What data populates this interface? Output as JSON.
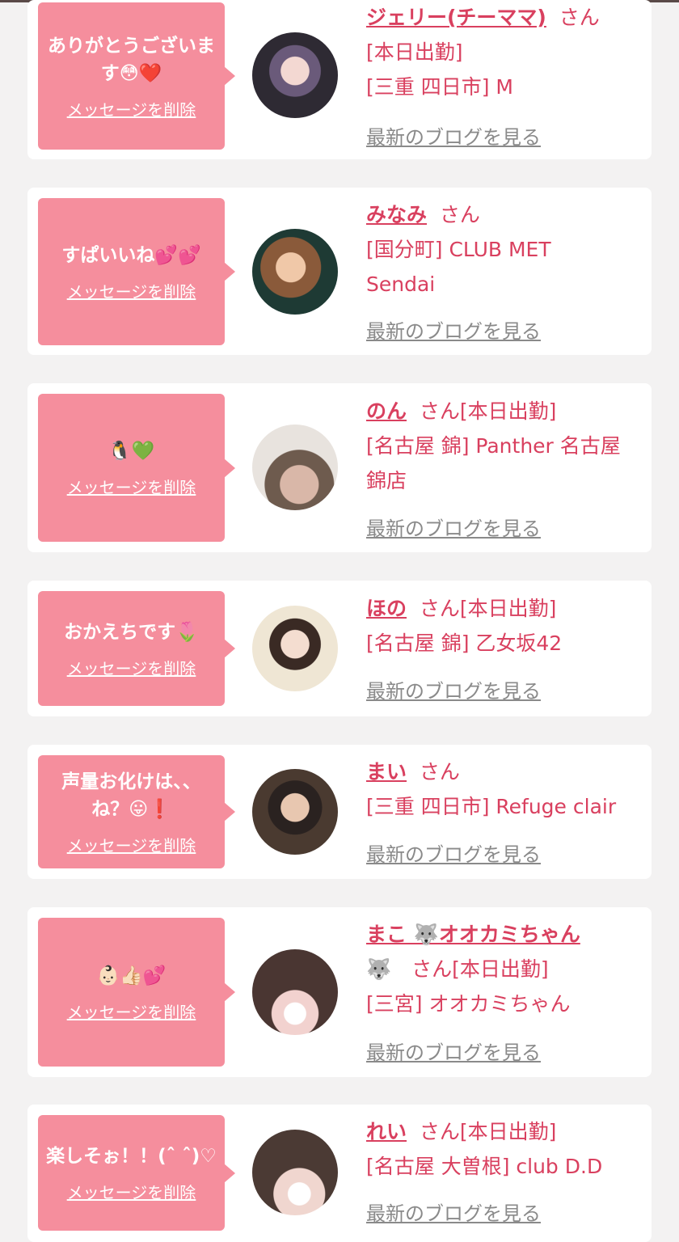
{
  "entries": [
    {
      "message": "ありがとうございます😳❤️",
      "delete": "メッセージを削除",
      "name": "ジェリー(チーママ)",
      "suffix": "さん",
      "line1": "[本日出勤]",
      "line2": "[三重 四日市] M",
      "line3": "",
      "blog": "最新のブログを見る"
    },
    {
      "message": "すぱいいね💕💕",
      "delete": "メッセージを削除",
      "name": "みなみ",
      "suffix": "さん",
      "line1": "[国分町] CLUB MET",
      "line2": "Sendai",
      "line3": "",
      "blog": "最新のブログを見る"
    },
    {
      "message": "🐧💚",
      "delete": "メッセージを削除",
      "name": "のん",
      "suffix": "さん[本日出勤]",
      "line1": "[名古屋 錦] Panther 名古屋",
      "line2": "錦店",
      "line3": "",
      "blog": "最新のブログを見る"
    },
    {
      "message": "おかえちです🌷",
      "delete": "メッセージを削除",
      "name": "ほの",
      "suffix": "さん[本日出勤]",
      "line1": "[名古屋 錦] 乙女坂42",
      "line2": "",
      "line3": "",
      "blog": "最新のブログを見る"
    },
    {
      "message": "声量お化けは、、ね？😛❗️",
      "delete": "メッセージを削除",
      "name": "まい",
      "suffix": "さん",
      "line1": "[三重 四日市] Refuge clair",
      "line2": "",
      "line3": "",
      "blog": "最新のブログを見る"
    },
    {
      "message": "👶🏻👍🏻💕",
      "delete": "メッセージを削除",
      "name": "まこ 🐺オオカミちゃん",
      "suffix": "🐺　さん[本日出勤]",
      "line1": "[三宮] オオカミちゃん",
      "line2": "",
      "line3": "",
      "blog": "最新のブログを見る"
    },
    {
      "message": "楽しそぉ！！(ˆ ˆ)♡",
      "delete": "メッセージを削除",
      "name": "れい",
      "suffix": "さん[本日出勤]",
      "line1": "[名古屋 大曽根] club D.D",
      "line2": "",
      "line3": "",
      "blog": "最新のブログを見る"
    }
  ],
  "colors": {
    "accent": "#d9405f",
    "bubble": "#f58e9d",
    "background": "#f3f2f2"
  },
  "icons": [
    "avatar-photo"
  ]
}
